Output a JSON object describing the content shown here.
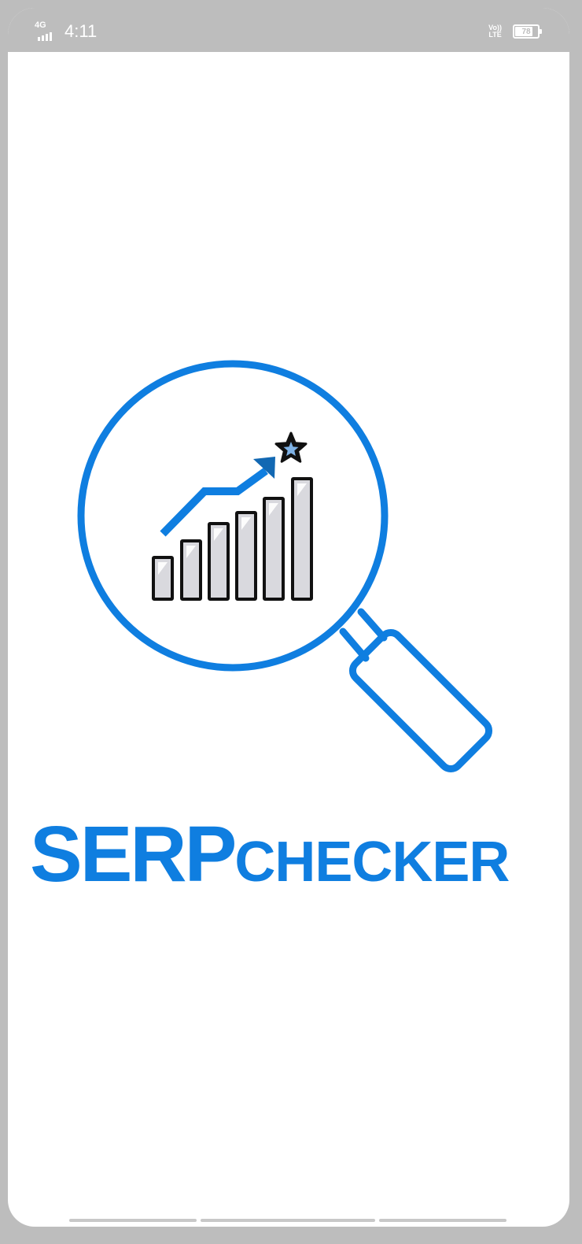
{
  "status_bar": {
    "network": "4G",
    "time": "4:11",
    "volte": "Vo))\nLTE",
    "battery_level": "78",
    "battery_fraction": 0.78,
    "signal_bars": 4
  },
  "logo": {
    "icon": "magnifier-chart-icon",
    "colors": {
      "brand": "#0f7ee0",
      "arrow": "#1268b3",
      "bar_fill": "#d9d9de",
      "outline": "#111111",
      "star_center": "#7fb2e5"
    }
  },
  "brand": {
    "part1": "SERP",
    "part2": "CHECKER"
  }
}
